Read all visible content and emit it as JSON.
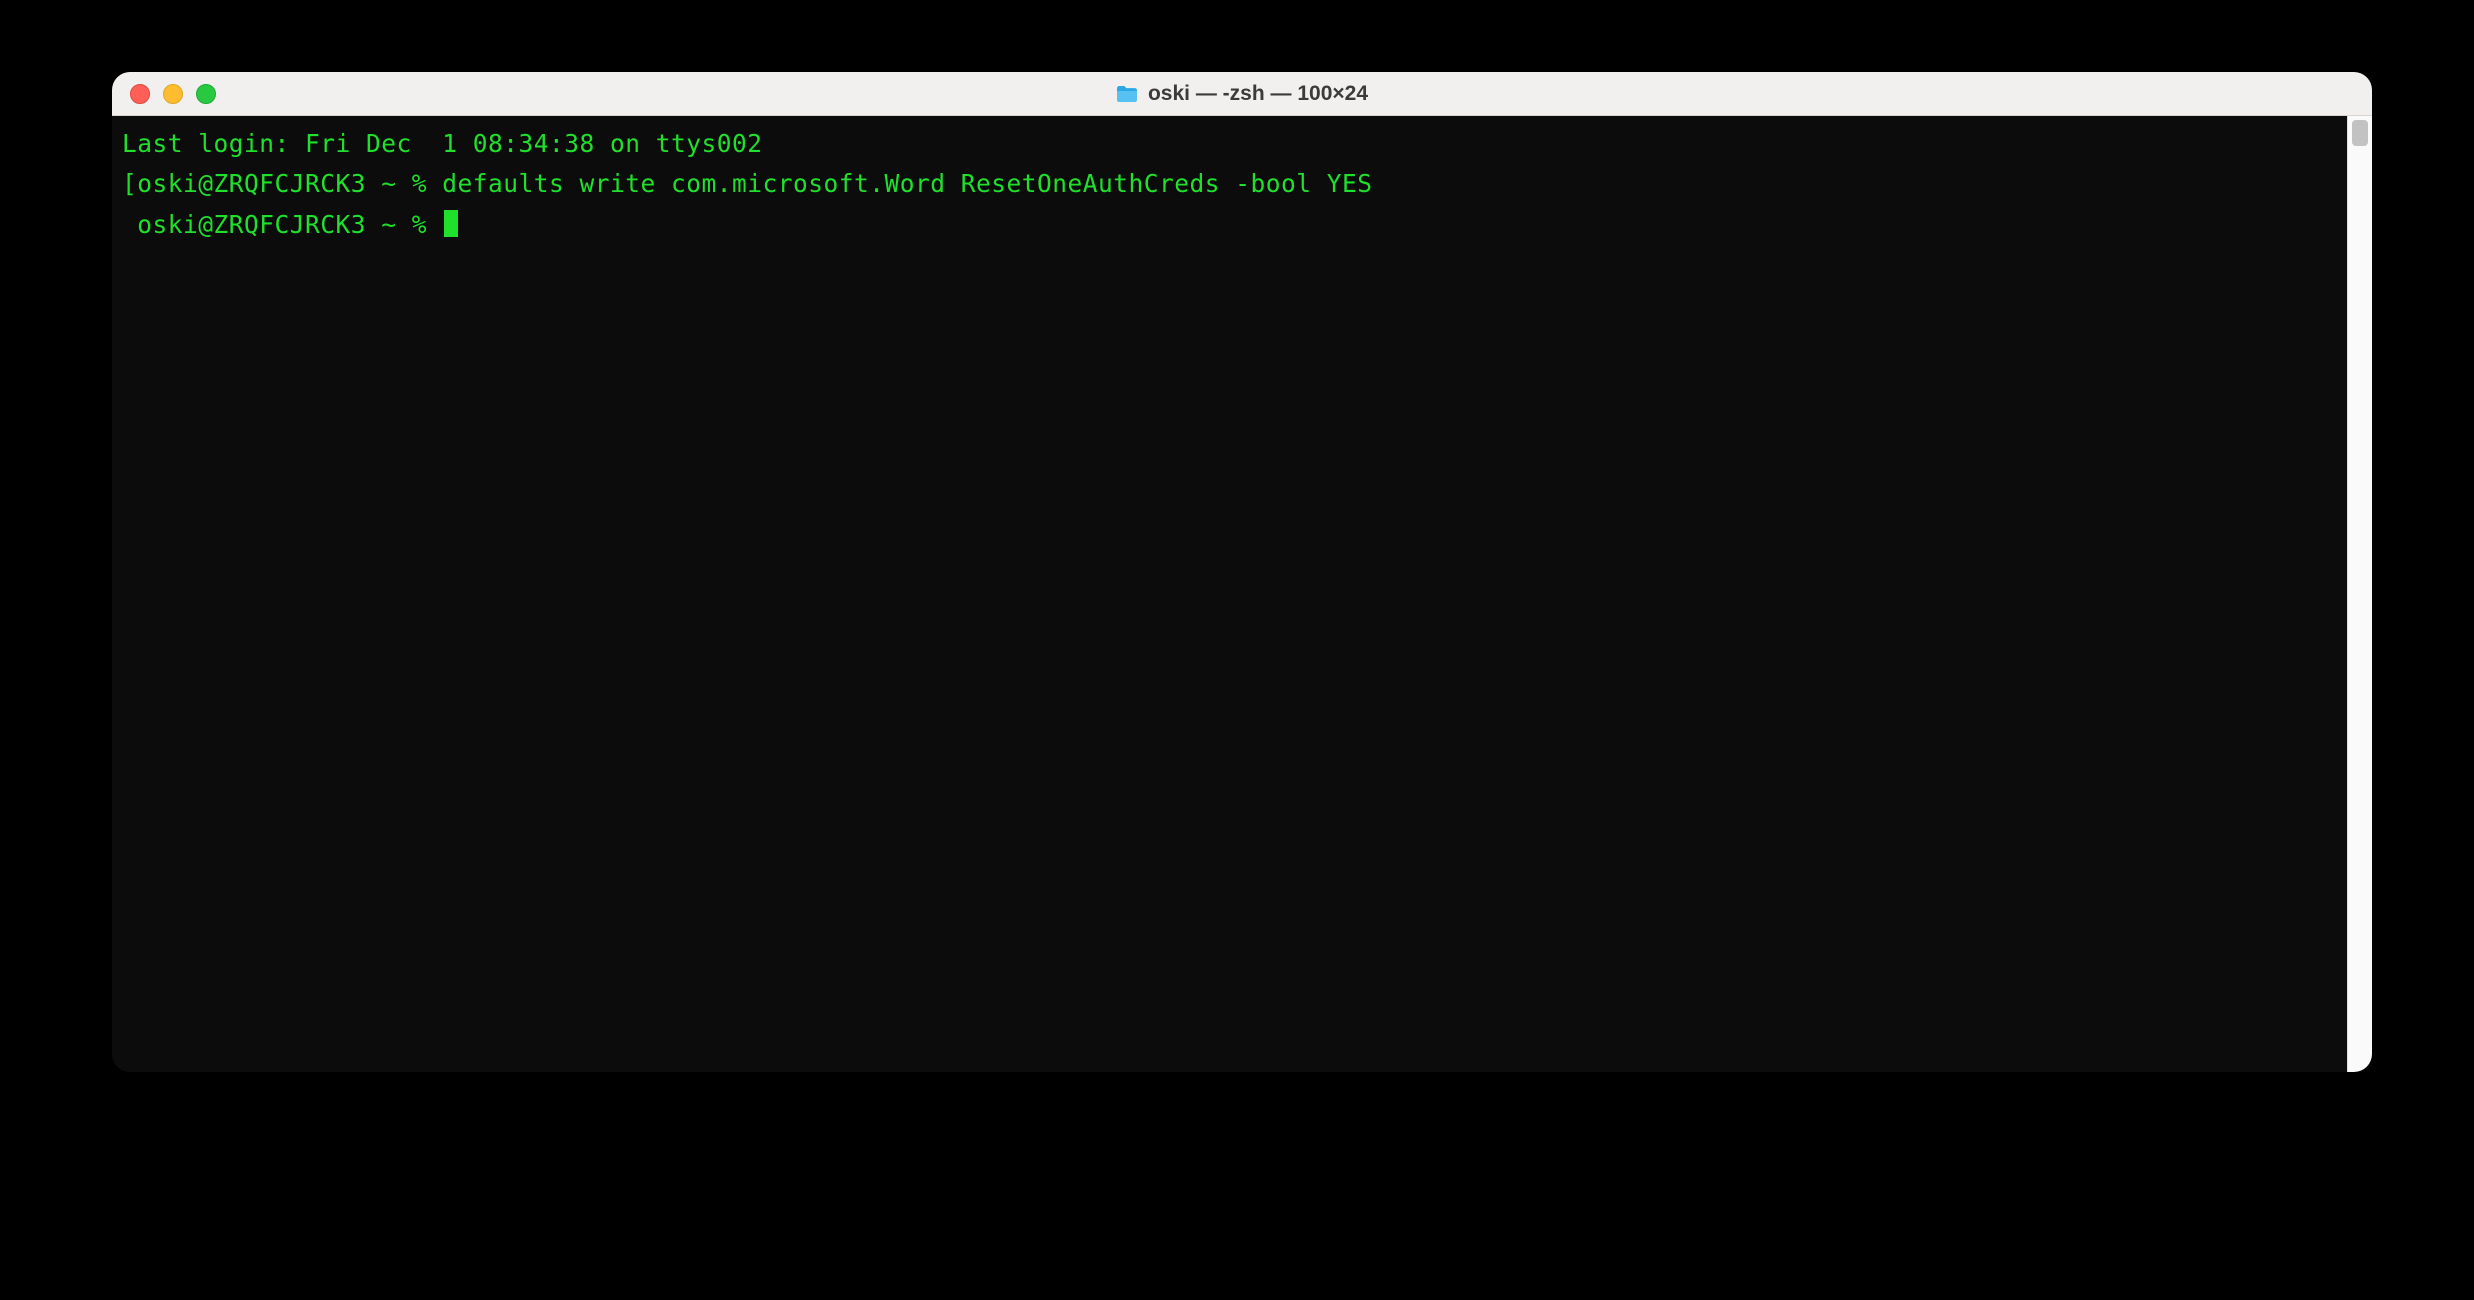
{
  "window": {
    "title": "oski — -zsh — 100×24"
  },
  "terminal": {
    "lines": [
      "Last login: Fri Dec  1 08:34:38 on ttys002",
      "[oski@ZRQFCJRCK3 ~ % defaults write com.microsoft.Word ResetOneAuthCreds -bool YES",
      " oski@ZRQFCJRCK3 ~ % "
    ]
  },
  "colors": {
    "terminal_bg": "#0c0c0c",
    "terminal_fg": "#1fe02b",
    "titlebar_bg": "#f2f0ef"
  }
}
